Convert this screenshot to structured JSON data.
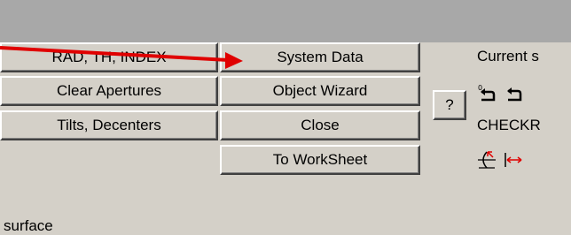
{
  "buttons": {
    "rad_th_index": "RAD, TH, INDEX",
    "system_data": "System Data",
    "clear_apertures": "Clear Apertures",
    "object_wizard": "Object Wizard",
    "tilts_decenters": "Tilts, Decenters",
    "close": "Close",
    "to_worksheet": "To WorkSheet",
    "help": "?"
  },
  "labels": {
    "current": "Current s",
    "checkr": "CHECKR",
    "surface": "surface"
  },
  "colors": {
    "titlebar": "#a8a8a8",
    "face": "#d4d0c8",
    "annotation_arrow": "#e00000"
  }
}
